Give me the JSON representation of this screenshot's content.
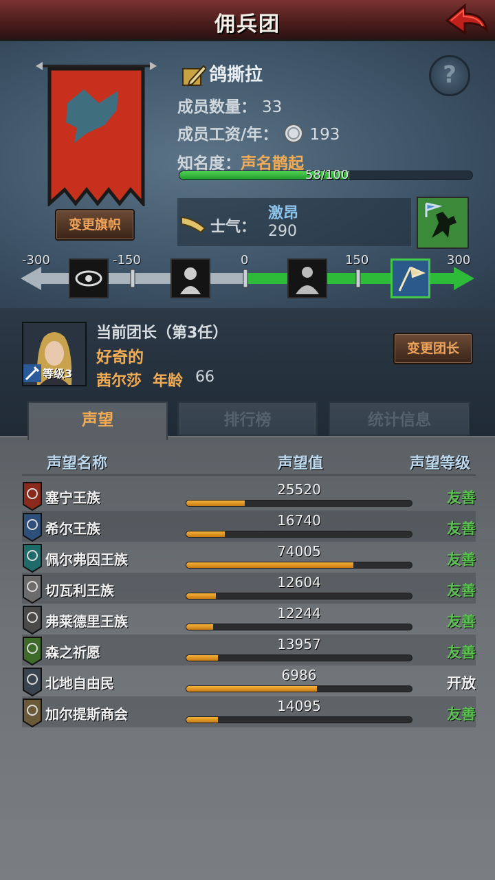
{
  "header": {
    "title": "佣兵团"
  },
  "company": {
    "name": "鸽撕拉",
    "members_label": "成员数量：",
    "members_value": "33",
    "wage_label": "成员工资/年：",
    "wage_value": "193",
    "fame_label": "知名度：",
    "fame_value": "声名鹊起",
    "fame_progress_text": "58/100",
    "fame_progress": 0.58,
    "change_banner_label": "变更旗帜"
  },
  "morale": {
    "label": "士气：",
    "state": "激昂",
    "value": "290",
    "scale_labels": [
      "-300",
      "-150",
      "0",
      "150",
      "300"
    ]
  },
  "leader": {
    "title": "当前团长（第3任）",
    "trait": "好奇的",
    "name": "茜尔莎",
    "age_label": "年龄",
    "age": "66",
    "level": "等级3",
    "change_label": "变更团长"
  },
  "tabs": [
    {
      "label": "声望",
      "active": true
    },
    {
      "label": "排行榜",
      "active": false
    },
    {
      "label": "统计信息",
      "active": false
    }
  ],
  "reputation": {
    "columns": [
      "声望名称",
      "声望值",
      "声望等级"
    ],
    "rows": [
      {
        "name": "塞宁王族",
        "value": "25520",
        "fill": 0.26,
        "level": "友善",
        "shield": "#8a2a1c"
      },
      {
        "name": "希尔王族",
        "value": "16740",
        "fill": 0.17,
        "level": "友善",
        "shield": "#2d4f7a"
      },
      {
        "name": "佩尔弗因王族",
        "value": "74005",
        "fill": 0.74,
        "level": "友善",
        "shield": "#1f6b6a"
      },
      {
        "name": "切瓦利王族",
        "value": "12604",
        "fill": 0.13,
        "level": "友善",
        "shield": "#6b6b6b"
      },
      {
        "name": "弗莱德里王族",
        "value": "12244",
        "fill": 0.12,
        "level": "友善",
        "shield": "#4a4a4a"
      },
      {
        "name": "森之祈愿",
        "value": "13957",
        "fill": 0.14,
        "level": "友善",
        "shield": "#3f6b2a"
      },
      {
        "name": "北地自由民",
        "value": "6986",
        "fill": 0.58,
        "level": "开放",
        "shield": "#3a4450"
      },
      {
        "name": "加尔提斯商会",
        "value": "14095",
        "fill": 0.14,
        "level": "友善",
        "shield": "#6b5a3a"
      }
    ]
  },
  "colors": {
    "accent_orange": "#f2ac54",
    "friendly_green": "#5bc251",
    "morale_green": "#1f9a2c",
    "header_red": "#7a3230"
  }
}
